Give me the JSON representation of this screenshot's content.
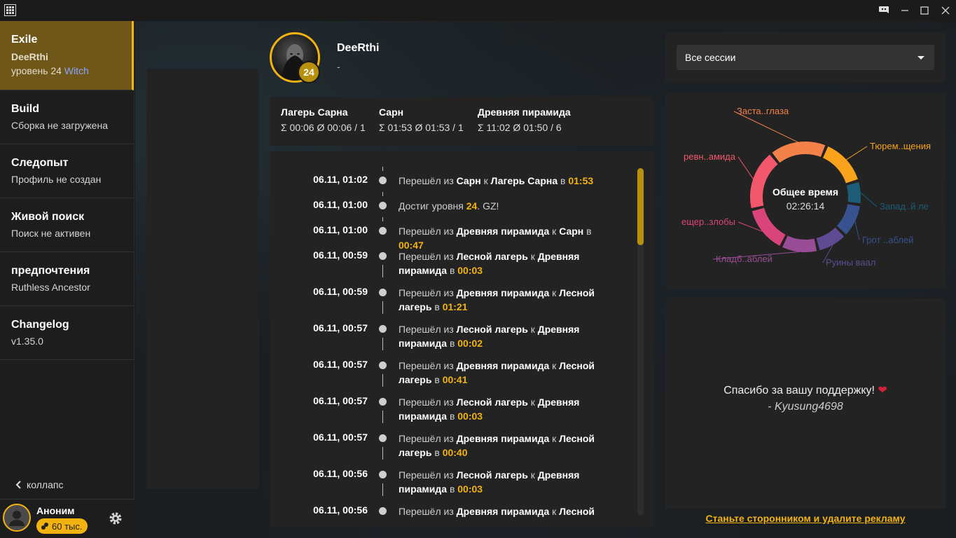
{
  "window": {
    "icons": [
      "app-logo-icon",
      "discord-icon",
      "minimize-icon",
      "maximize-icon",
      "close-icon"
    ]
  },
  "sidebar": {
    "exile": {
      "title": "Exile",
      "name": "DeeRthi",
      "level_prefix": "уровень 24",
      "class": "Witch"
    },
    "items": [
      {
        "title": "Build",
        "sub": "Сборка не загружена"
      },
      {
        "title": "Следопыт",
        "sub": "Профиль не создан"
      },
      {
        "title": "Живой поиск",
        "sub": "Поиск не активен"
      },
      {
        "title": "предпочтения",
        "sub": "Ruthless Ancestor"
      },
      {
        "title": "Changelog",
        "sub": "v1.35.0"
      }
    ],
    "collapse_label": "коллапс",
    "user": {
      "name": "Аноним",
      "coins": "60 тыс."
    }
  },
  "profile": {
    "name": "DeeRthi",
    "subtitle": "-",
    "level": "24"
  },
  "stats": [
    {
      "title": "Лагерь Сарна",
      "value": "Σ 00:06  Ø 00:06 / 1"
    },
    {
      "title": "Сарн",
      "value": "Σ 01:53  Ø 01:53 / 1"
    },
    {
      "title": "Древняя пирамида",
      "value": "Σ 11:02  Ø 01:50 / 6"
    }
  ],
  "timeline": {
    "word_moved": "Перешёл из",
    "word_to": "к",
    "word_in": "в",
    "word_reached": "Достиг уровня",
    "events": [
      {
        "date": "06.11, 01:02",
        "type": "move",
        "from": "Сарн",
        "to": "Лагерь Сарна",
        "time": "01:53"
      },
      {
        "date": "06.11, 01:00",
        "type": "level",
        "level": "24",
        "suffix": ". GZ!"
      },
      {
        "date": "06.11, 01:00",
        "type": "move",
        "from": "Древняя пирамида",
        "to": "Сарн",
        "time": "00:47"
      },
      {
        "date": "06.11, 00:59",
        "type": "move",
        "from": "Лесной лагерь",
        "to": "Древняя пирамида",
        "time": "00:03"
      },
      {
        "date": "06.11, 00:59",
        "type": "move",
        "from": "Древняя пирамида",
        "to": "Лесной лагерь",
        "time": "01:21"
      },
      {
        "date": "06.11, 00:57",
        "type": "move",
        "from": "Лесной лагерь",
        "to": "Древняя пирамида",
        "time": "00:02"
      },
      {
        "date": "06.11, 00:57",
        "type": "move",
        "from": "Древняя пирамида",
        "to": "Лесной лагерь",
        "time": "00:41"
      },
      {
        "date": "06.11, 00:57",
        "type": "move",
        "from": "Лесной лагерь",
        "to": "Древняя пирамида",
        "time": "00:03"
      },
      {
        "date": "06.11, 00:57",
        "type": "move",
        "from": "Древняя пирамида",
        "to": "Лесной лагерь",
        "time": "00:40"
      },
      {
        "date": "06.11, 00:56",
        "type": "move",
        "from": "Лесной лагерь",
        "to": "Древняя пирамида",
        "time": "00:03"
      },
      {
        "date": "06.11, 00:56",
        "type": "move",
        "from": "Древняя пирамида",
        "to": "Лесной",
        "time": ""
      }
    ]
  },
  "session": {
    "selected": "Все сессии"
  },
  "donut": {
    "center_title": "Общее время",
    "center_value": "02:26:14",
    "segments": [
      {
        "label": "Заста..глаза",
        "value": 17,
        "color": "#f3814a"
      },
      {
        "label": "Тюрем..щения",
        "value": 14,
        "color": "#f9a21b"
      },
      {
        "label": "Запад..й ле",
        "value": 7,
        "color": "#1d5d78"
      },
      {
        "label": "Грот ..аблей",
        "value": 10,
        "color": "#37528f"
      },
      {
        "label": "Руины ваал",
        "value": 9,
        "color": "#5f4b93"
      },
      {
        "label": "Кладб..аблей",
        "value": 11,
        "color": "#9a4d97"
      },
      {
        "label": "ещер..злобы",
        "value": 14,
        "color": "#d9457a"
      },
      {
        "label": "ревн..амида",
        "value": 18,
        "color": "#f3576b"
      }
    ]
  },
  "support": {
    "text": "Спасибо за вашу поддержку!",
    "author": "- Kyusung4698"
  },
  "ad_link": "Станьте сторонником и удалите рекламу"
}
